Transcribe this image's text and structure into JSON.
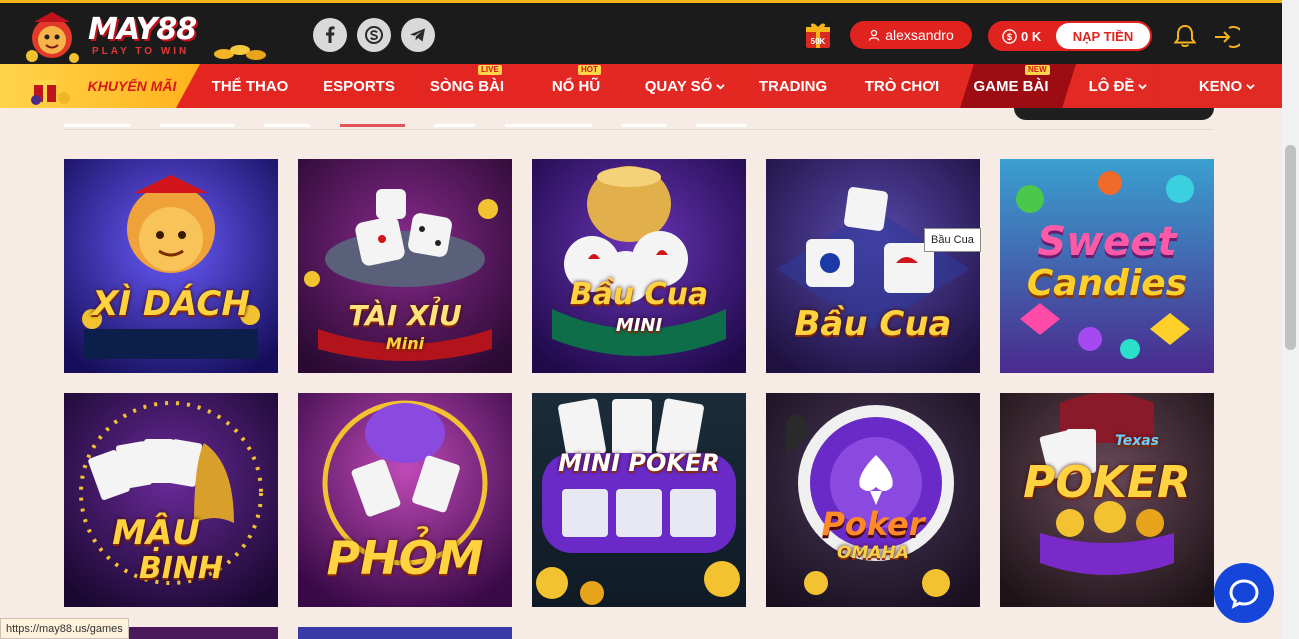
{
  "header": {
    "brand": "MAY88",
    "tagline": "PLAY TO WIN",
    "gift_badge": "50K",
    "username": "alexsandro",
    "balance": "0 K",
    "deposit_label": "NẠP TIỀN",
    "social": [
      "facebook-icon",
      "skype-icon",
      "telegram-icon"
    ]
  },
  "nav": {
    "items": [
      {
        "label": "KHUYẾN MÃI"
      },
      {
        "label": "THỂ THAO"
      },
      {
        "label": "ESPORTS"
      },
      {
        "label": "SÒNG BÀI",
        "badge": "LIVE"
      },
      {
        "label": "NỔ HŨ",
        "badge": "HOT"
      },
      {
        "label": "QUAY SỐ"
      },
      {
        "label": "TRADING"
      },
      {
        "label": "TRÒ CHƠI"
      },
      {
        "label": "GAME BÀI",
        "badge": "NEW"
      },
      {
        "label": "LÔ ĐỀ"
      },
      {
        "label": "KENO"
      }
    ]
  },
  "games": [
    {
      "title": "XÌ DÁCH"
    },
    {
      "title": "TÀI XỈU",
      "subtitle": "Mini"
    },
    {
      "title": "Bầu Cua",
      "subtitle": "MINI"
    },
    {
      "title": "Bầu Cua"
    },
    {
      "title": "Sweet",
      "subtitle": "Candies"
    },
    {
      "title": "MẬU",
      "subtitle": "BINH"
    },
    {
      "title": "PHỎM"
    },
    {
      "title": "MINI POKER"
    },
    {
      "title": "Poker",
      "subtitle": "OMAHA"
    },
    {
      "title": "POKER",
      "subtitle": "Texas"
    }
  ],
  "tooltip": "Bầu Cua",
  "status_url": "https://may88.us/games",
  "colors": {
    "header_bg": "#1b1b1b",
    "nav_red": "#e52420",
    "brand_red": "#e0231f",
    "promo_yellow": "#ffc233",
    "page_bg": "#f7ece5",
    "chat_blue": "#1546d9"
  }
}
